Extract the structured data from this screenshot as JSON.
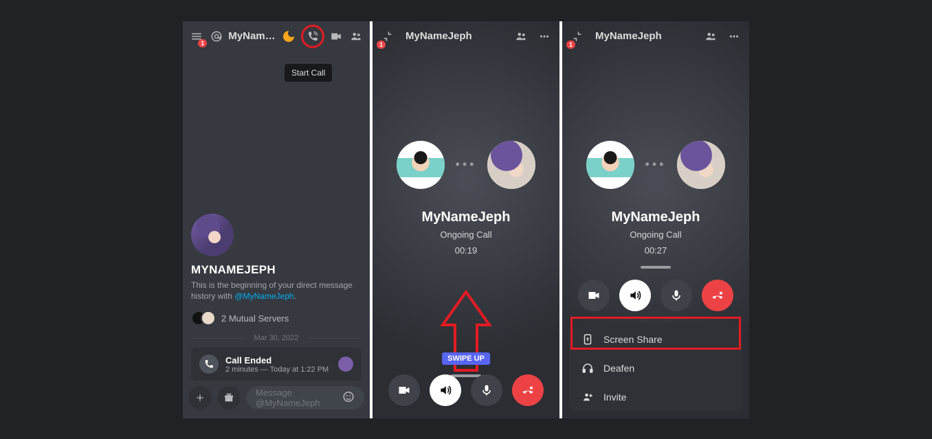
{
  "p1": {
    "menu_badge": "1",
    "title": "MyNameJ…",
    "tooltip": "Start Call",
    "username_heading": "MYNAMEJEPH",
    "history_prefix": "This is the beginning of your direct message history with ",
    "mention": "@MyNameJeph",
    "history_suffix": ".",
    "mutual_servers": "2 Mutual Servers",
    "date": "Mar 30, 2022",
    "call_ended_title": "Call Ended",
    "call_ended_sub": "2 minutes — Today at 1:22 PM",
    "composer_placeholder": "Message @MyNameJeph"
  },
  "p2": {
    "badge": "1",
    "title": "MyNameJeph",
    "name": "MyNameJeph",
    "status": "Ongoing Call",
    "time": "00:19",
    "swipe": "SWIPE UP"
  },
  "p3": {
    "badge": "1",
    "title": "MyNameJeph",
    "name": "MyNameJeph",
    "status": "Ongoing Call",
    "time": "00:27",
    "sheet": {
      "screen_share": "Screen Share",
      "deafen": "Deafen",
      "invite": "Invite"
    }
  }
}
